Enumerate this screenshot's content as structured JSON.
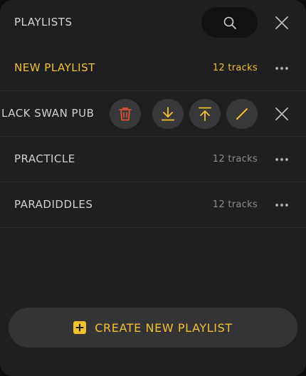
{
  "header": {
    "title": "PLAYLISTS",
    "search_icon": "search-icon",
    "close_icon": "close-icon"
  },
  "playlists": [
    {
      "name": "NEW PLAYLIST",
      "tracks": "12 tracks",
      "active": true
    },
    {
      "name": "LACK SWAN PUB",
      "editing": true
    },
    {
      "name": "PRACTICLE",
      "tracks": "12 tracks"
    },
    {
      "name": "PARADIDDLES",
      "tracks": "12 tracks"
    }
  ],
  "row_actions": {
    "icons": [
      "trash-icon",
      "download-icon",
      "upload-icon",
      "rename-icon"
    ],
    "close_icon": "close-icon"
  },
  "create_button": {
    "label": "CREATE NEW PLAYLIST",
    "icon": "plus-square-icon"
  },
  "colors": {
    "accent": "#f2c12e",
    "danger": "#e0502f",
    "background": "#1f1f21"
  }
}
